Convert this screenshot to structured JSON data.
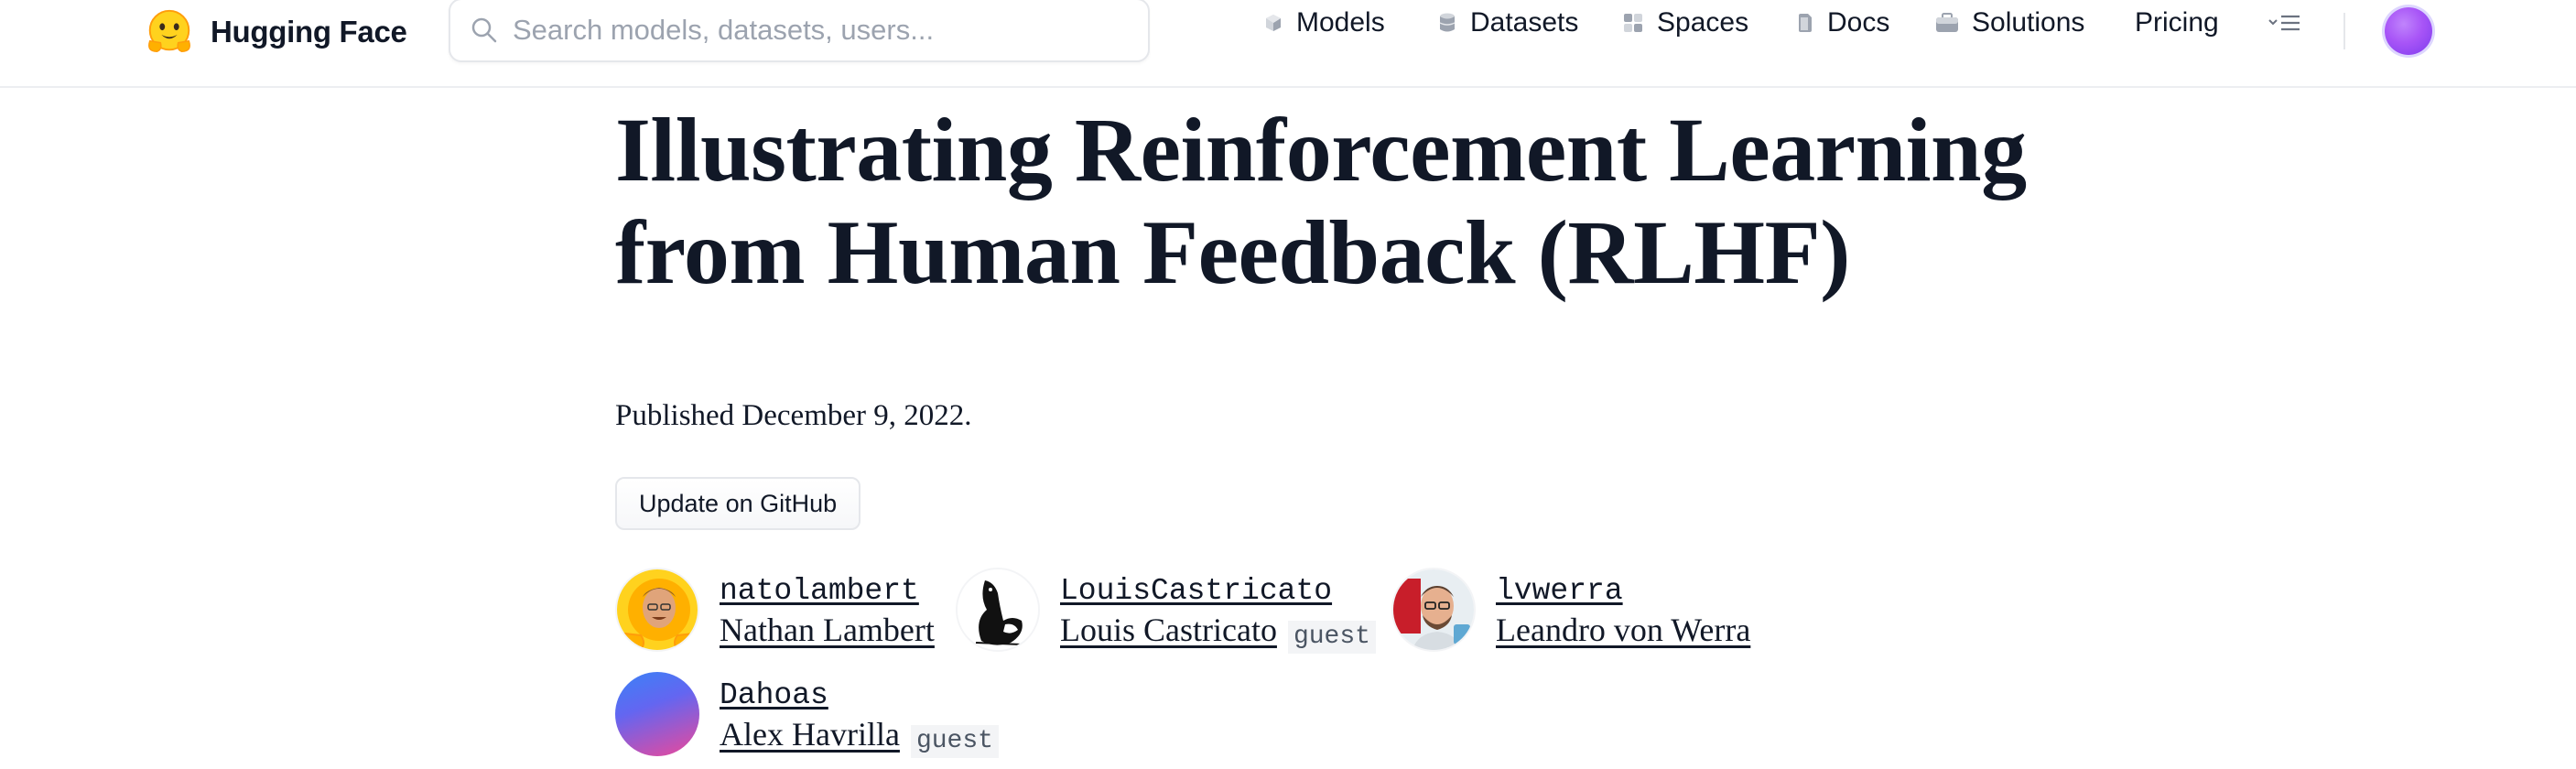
{
  "header": {
    "brand": "Hugging Face",
    "logo_icon": "hugging-face-emoji",
    "search": {
      "placeholder": "Search models, datasets, users..."
    },
    "nav": [
      {
        "label": "Models",
        "icon": "cube-icon"
      },
      {
        "label": "Datasets",
        "icon": "database-icon"
      },
      {
        "label": "Spaces",
        "icon": "grid-icon"
      },
      {
        "label": "Docs",
        "icon": "doc-icon"
      },
      {
        "label": "Solutions",
        "icon": "briefcase-icon"
      },
      {
        "label": "Pricing",
        "icon": ""
      }
    ],
    "more_icon": "chevron-menu-icon"
  },
  "article": {
    "title_line1": "Illustrating Reinforcement Learning",
    "title_line2": "from Human Feedback (RLHF)",
    "published": "Published December 9, 2022.",
    "github_button": "Update on GitHub",
    "authors": [
      {
        "username": "natolambert",
        "name": "Nathan Lambert",
        "guest": ""
      },
      {
        "username": "LouisCastricato",
        "name": "Louis Castricato",
        "guest": "guest"
      },
      {
        "username": "lvwerra",
        "name": "Leandro von Werra",
        "guest": ""
      },
      {
        "username": "Dahoas",
        "name": "Alex Havrilla",
        "guest": "guest"
      }
    ]
  },
  "colors": {
    "text": "#111827",
    "muted": "#9ca3af",
    "border": "#e5e7eb",
    "avatar_purple": "#a855f7"
  }
}
